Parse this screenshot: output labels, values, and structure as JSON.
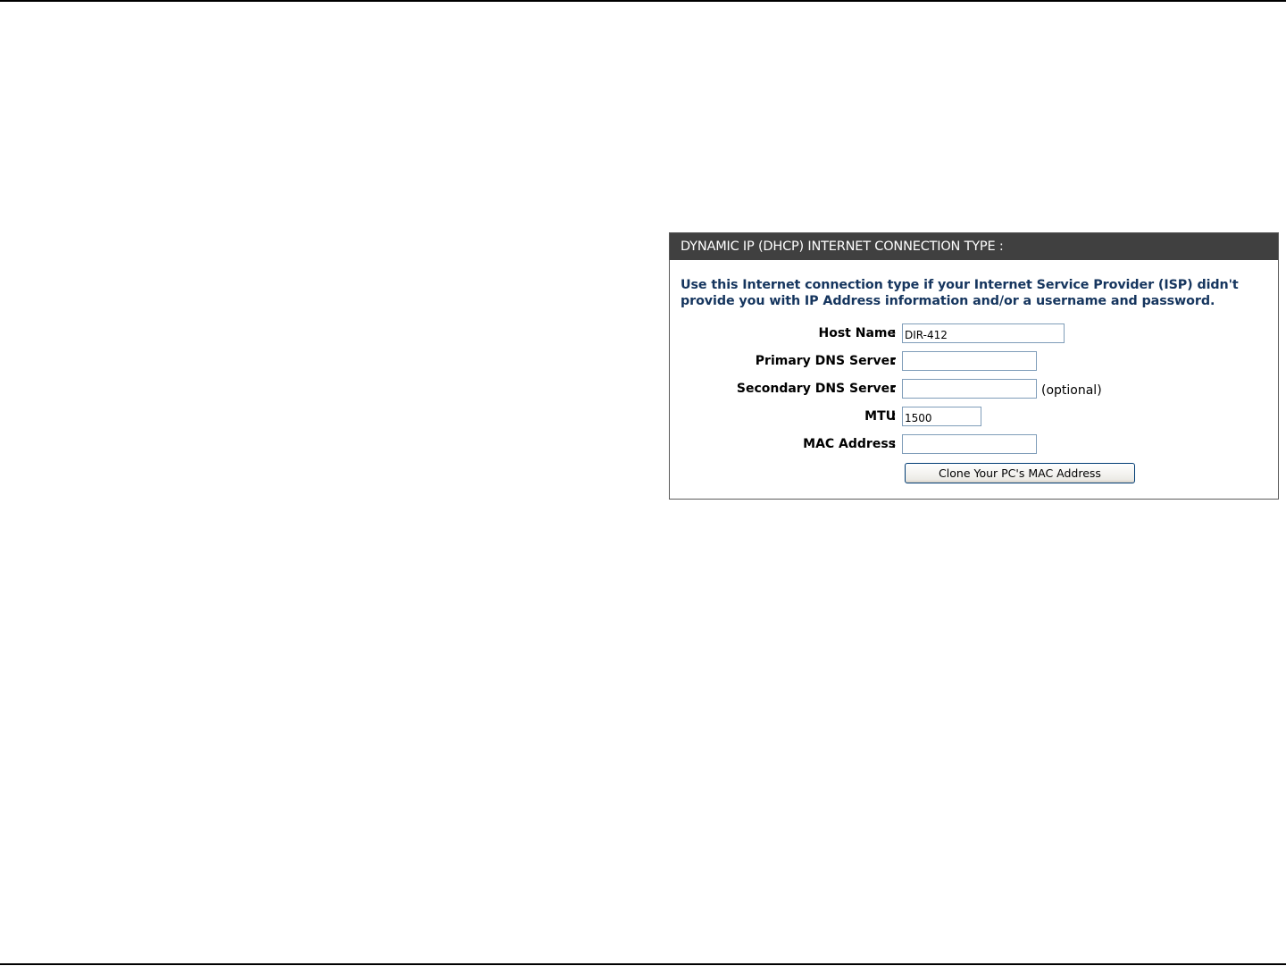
{
  "panel": {
    "title": "DYNAMIC IP (DHCP) INTERNET CONNECTION TYPE :",
    "description": "Use this Internet connection type if your Internet Service Provider (ISP) didn't provide you with IP Address information and/or a username and password."
  },
  "form": {
    "host_name": {
      "label": "Host Name",
      "colon": ":",
      "value": "DIR-412"
    },
    "primary_dns": {
      "label": "Primary DNS Server",
      "colon": ":",
      "value": ""
    },
    "secondary_dns": {
      "label": "Secondary DNS Server",
      "colon": ":",
      "value": "",
      "hint": "(optional)"
    },
    "mtu": {
      "label": "MTU",
      "colon": ":",
      "value": "1500"
    },
    "mac_address": {
      "label": "MAC Address",
      "colon": ":",
      "value": ""
    },
    "clone_button_label": "Clone Your PC's MAC Address"
  }
}
